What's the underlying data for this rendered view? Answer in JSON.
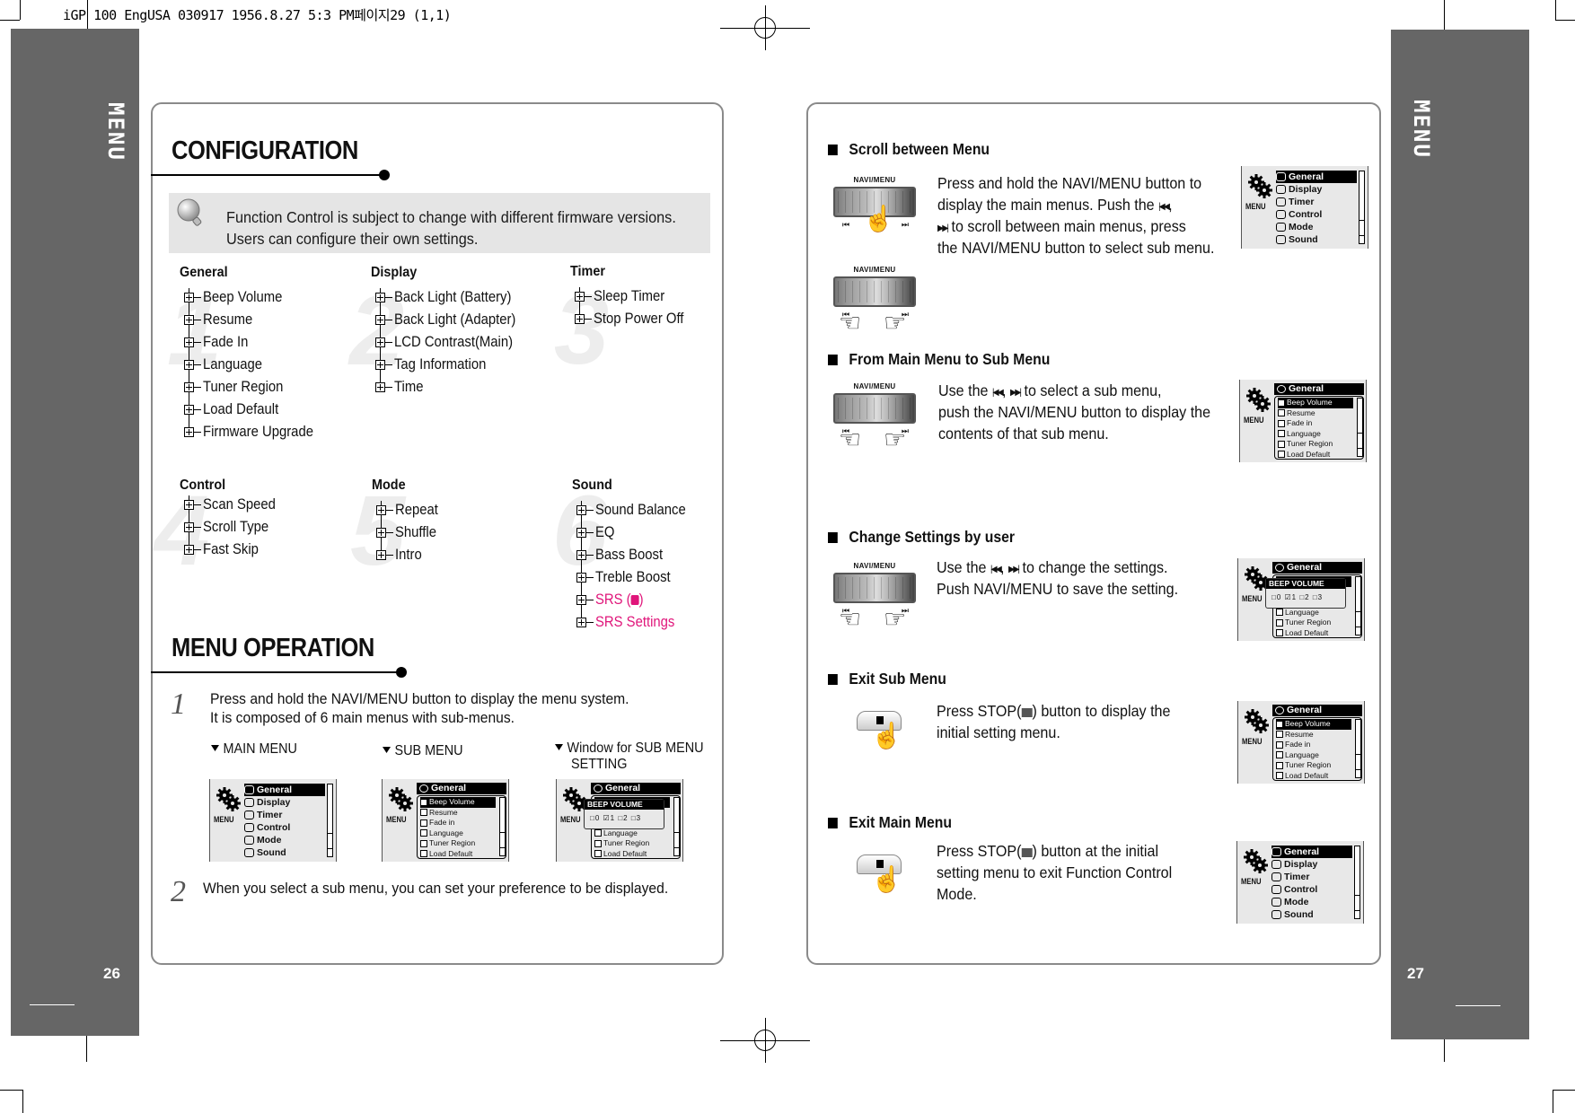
{
  "print_header": "iGP 100 EngUSA 030917  1956.8.27 5:3 PM페이지29 (1,1)",
  "left_page": {
    "side_tab": "MENU",
    "page_number": "26",
    "configuration": {
      "title": "CONFIGURATION",
      "info_icon": "lightbulb-icon",
      "info_lines": [
        "Function Control is subject to change with different firmware versions.",
        "Users can configure their own settings."
      ],
      "groups": [
        {
          "num": "1",
          "title": "General",
          "items": [
            "Beep Volume",
            "Resume",
            "Fade In",
            "Language",
            "Tuner Region",
            "Load Default",
            "Firmware Upgrade"
          ]
        },
        {
          "num": "2",
          "title": "Display",
          "items": [
            "Back Light (Battery)",
            "Back Light (Adapter)",
            "LCD Contrast(Main)",
            "Tag Information",
            "Time"
          ]
        },
        {
          "num": "3",
          "title": "Timer",
          "items": [
            "Sleep Timer",
            "Stop Power Off"
          ]
        },
        {
          "num": "4",
          "title": "Control",
          "items": [
            "Scan Speed",
            "Scroll Type",
            "Fast Skip"
          ]
        },
        {
          "num": "5",
          "title": "Mode",
          "items": [
            "Repeat",
            "Shuffle",
            "Intro"
          ]
        },
        {
          "num": "6",
          "title": "Sound",
          "items": [
            "Sound Balance",
            "EQ",
            "Bass Boost",
            "Treble Boost",
            "SRS (",
            ")",
            "SRS Settings"
          ]
        }
      ],
      "highlight_color": "#e0157a"
    },
    "menu_operation": {
      "title": "MENU OPERATION",
      "step1_num": "1",
      "step1_lines": [
        "Press and hold the NAVI/MENU button to display the menu system.",
        "It is composed of 6 main menus with sub-menus."
      ],
      "shot_labels": [
        "MAIN MENU",
        "SUB MENU",
        "Window for SUB MENU",
        "SETTING"
      ],
      "step2_num": "2",
      "step2_text": "When you select a sub menu, you can set your preference to be displayed."
    }
  },
  "lcd": {
    "menu_label": "MENU",
    "main_items": [
      "General",
      "Display",
      "Timer",
      "Control",
      "Mode",
      "Sound"
    ],
    "sub_header": "General",
    "sub_items": [
      "Beep Volume",
      "Resume",
      "Fade in",
      "Language",
      "Tuner Region",
      "Load Default"
    ],
    "popup_title": "BEEP VOLUME",
    "popup_options": "□0 ☑1 □2 □3"
  },
  "right_page": {
    "side_tab": "MENU",
    "page_number": "27",
    "navi_label": "NAVI/MENU",
    "skip_back": "⏮",
    "skip_fwd": "⏭",
    "items": [
      {
        "title": "Scroll between Menu",
        "lines": [
          "Press and hold the NAVI/MENU button to",
          "display the main menus. Push the",
          ",",
          "to scroll between main menus, press",
          "the NAVI/MENU button to select sub menu."
        ]
      },
      {
        "title": "From Main Menu to Sub Menu",
        "lines": [
          "Use the",
          ",",
          "to select a sub menu,",
          "push the NAVI/MENU button to display the",
          "contents of that sub menu."
        ]
      },
      {
        "title": "Change Settings by user",
        "lines": [
          "Use the",
          ",",
          "to change the settings.",
          "Push NAVI/MENU to save the setting."
        ]
      },
      {
        "title": "Exit Sub Menu",
        "lines": [
          "Press STOP(",
          ") button to display the",
          "initial setting menu."
        ]
      },
      {
        "title": "Exit Main Menu",
        "lines": [
          "Press STOP(",
          ") button at the initial",
          "setting menu to exit Function Control",
          "Mode."
        ]
      }
    ]
  }
}
